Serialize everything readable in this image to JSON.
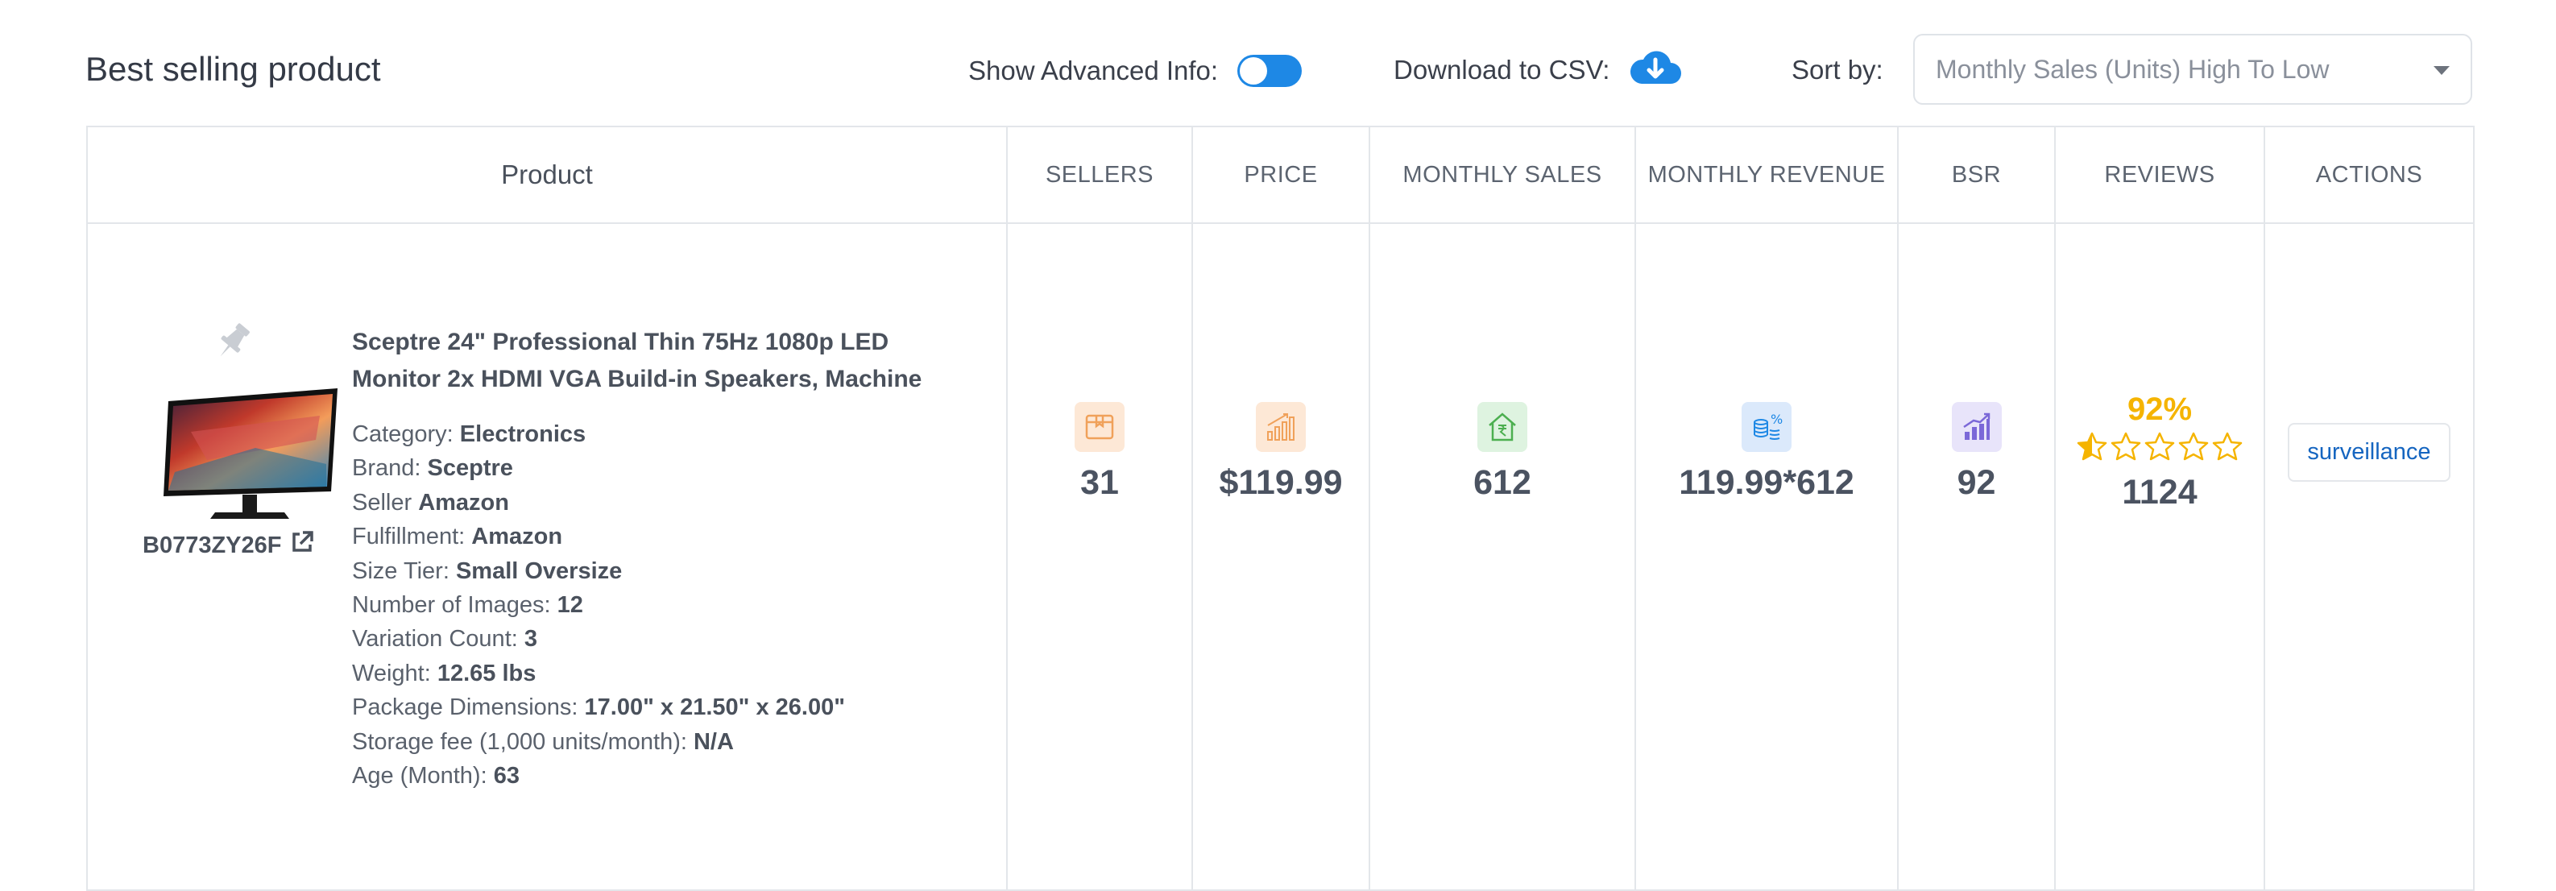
{
  "header": {
    "title": "Best selling product",
    "advanced_info_label": "Show Advanced Info:",
    "advanced_info_on": true,
    "download_label": "Download to CSV:",
    "sort_label": "Sort by:",
    "sort_value": "Monthly Sales (Units) High To Low"
  },
  "columns": [
    "Product",
    "SELLERS",
    "PRICE",
    "MONTHLY SALES",
    "MONTHLY REVENUE",
    "BSR",
    "REVIEWS",
    "ACTIONS"
  ],
  "product": {
    "asin": "B0773ZY26F",
    "title": "Sceptre 24\" Professional Thin 75Hz 1080p LED Monitor 2x HDMI VGA Build-in Speakers, Machine",
    "details": [
      {
        "label": "Category: ",
        "value": "Electronics"
      },
      {
        "label": "Brand: ",
        "value": "Sceptre"
      },
      {
        "label": "Seller ",
        "value": "Amazon"
      },
      {
        "label": "Fulfillment: ",
        "value": "Amazon"
      },
      {
        "label": "Size Tier: ",
        "value": "Small Oversize"
      },
      {
        "label": "Number of Images: ",
        "value": "12"
      },
      {
        "label": "Variation Count: ",
        "value": "3"
      },
      {
        "label": "Weight: ",
        "value": "12.65 lbs"
      },
      {
        "label": "Package Dimensions: ",
        "value": "17.00\" x 21.50\" x 26.00\""
      },
      {
        "label": "Storage fee (1,000 units/month): ",
        "value": "N/A"
      },
      {
        "label": "Age (Month): ",
        "value": "63"
      }
    ],
    "sellers": "31",
    "price": "$119.99",
    "monthly_sales": "612",
    "monthly_revenue": "119.99*612",
    "bsr": "92",
    "review_percent": "92%",
    "review_stars": 0.5,
    "reviews": "1124",
    "action_label": "surveillance"
  },
  "icons": {
    "sellers": "box-icon",
    "price": "bar-chart-icon",
    "monthly_sales": "rupee-house-icon",
    "monthly_revenue": "coins-percent-icon",
    "bsr": "growth-chart-icon",
    "reviews": "star-icon"
  },
  "colors": {
    "accent": "#1e88e5",
    "sellers": "#f0a15a",
    "price": "#f0a15a",
    "monthly_sales": "#4caf50",
    "monthly_revenue": "#1e88e5",
    "bsr": "#7b68d8",
    "stars": "#f5b400"
  }
}
